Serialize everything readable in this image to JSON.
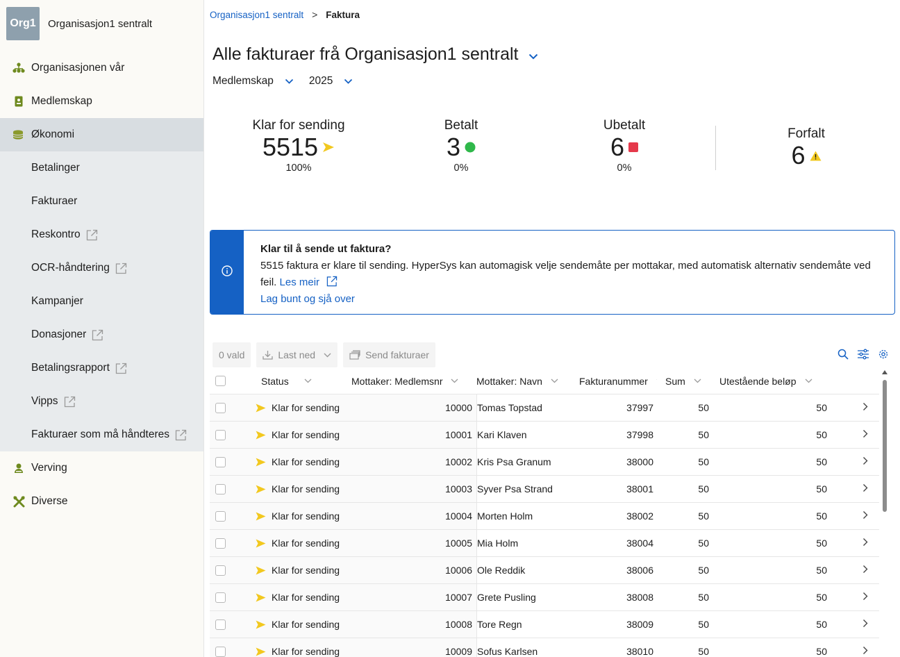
{
  "sidebar": {
    "org_logo": "Org1",
    "org_name": "Organisasjon1 sentralt",
    "items": [
      {
        "label": "Organisasjonen vår",
        "icon": "org-tree-icon"
      },
      {
        "label": "Medlemskap",
        "icon": "member-card-icon"
      },
      {
        "label": "Økonomi",
        "icon": "coins-icon",
        "active": true
      },
      {
        "label": "Verving",
        "icon": "recruit-icon"
      },
      {
        "label": "Diverse",
        "icon": "tools-icon"
      }
    ],
    "sub_items": [
      {
        "label": "Betalinger",
        "external": false
      },
      {
        "label": "Fakturaer",
        "external": false
      },
      {
        "label": "Reskontro",
        "external": true
      },
      {
        "label": "OCR-håndtering",
        "external": true
      },
      {
        "label": "Kampanjer",
        "external": false
      },
      {
        "label": "Donasjoner",
        "external": true
      },
      {
        "label": "Betalingsrapport",
        "external": true
      },
      {
        "label": "Vipps",
        "external": true
      },
      {
        "label": "Fakturaer som må håndteres",
        "external": true
      }
    ]
  },
  "breadcrumb": {
    "parent": "Organisasjon1 sentralt",
    "separator": ">",
    "current": "Faktura"
  },
  "page": {
    "title": "Alle fakturaer frå Organisasjon1 sentralt",
    "filter_type": "Medlemskap",
    "filter_year": "2025"
  },
  "stats": {
    "ready": {
      "label": "Klar for sending",
      "value": "5515",
      "pct": "100%"
    },
    "paid": {
      "label": "Betalt",
      "value": "3",
      "pct": "0%"
    },
    "unpaid": {
      "label": "Ubetalt",
      "value": "6",
      "pct": "0%"
    },
    "overdue": {
      "label": "Forfalt",
      "value": "6"
    }
  },
  "banner": {
    "title": "Klar til å sende ut faktura?",
    "text": "5515 faktura er klare til sending. HyperSys kan automagisk velje sendemåte per mottakar, med automatisk alternativ sendemåte ved feil.",
    "read_more": "Les meir",
    "action": "Lag bunt og sjå over"
  },
  "toolbar": {
    "selected": "0 vald",
    "download": "Last ned",
    "send": "Send fakturaer"
  },
  "table": {
    "headers": {
      "status": "Status",
      "member_no": "Mottaker: Medlemsnr",
      "name": "Mottaker: Navn",
      "invoice_no": "Fakturanummer",
      "sum": "Sum",
      "outstanding": "Utestående beløp"
    },
    "rows": [
      {
        "status": "Klar for sending",
        "member_no": "10000",
        "name": "Tomas Topstad",
        "invoice_no": "37997",
        "sum": "50",
        "outstanding": "50"
      },
      {
        "status": "Klar for sending",
        "member_no": "10001",
        "name": "Kari Klaven",
        "invoice_no": "37998",
        "sum": "50",
        "outstanding": "50"
      },
      {
        "status": "Klar for sending",
        "member_no": "10002",
        "name": "Kris Psa Granum",
        "invoice_no": "38000",
        "sum": "50",
        "outstanding": "50"
      },
      {
        "status": "Klar for sending",
        "member_no": "10003",
        "name": "Syver Psa Strand",
        "invoice_no": "38001",
        "sum": "50",
        "outstanding": "50"
      },
      {
        "status": "Klar for sending",
        "member_no": "10004",
        "name": "Morten Holm",
        "invoice_no": "38002",
        "sum": "50",
        "outstanding": "50"
      },
      {
        "status": "Klar for sending",
        "member_no": "10005",
        "name": "Mia Holm",
        "invoice_no": "38004",
        "sum": "50",
        "outstanding": "50"
      },
      {
        "status": "Klar for sending",
        "member_no": "10006",
        "name": "Ole Reddik",
        "invoice_no": "38006",
        "sum": "50",
        "outstanding": "50"
      },
      {
        "status": "Klar for sending",
        "member_no": "10007",
        "name": "Grete Pusling",
        "invoice_no": "38008",
        "sum": "50",
        "outstanding": "50"
      },
      {
        "status": "Klar for sending",
        "member_no": "10008",
        "name": "Tore Regn",
        "invoice_no": "38009",
        "sum": "50",
        "outstanding": "50"
      },
      {
        "status": "Klar for sending",
        "member_no": "10009",
        "name": "Sofus Karlsen",
        "invoice_no": "38010",
        "sum": "50",
        "outstanding": "50"
      }
    ]
  },
  "colors": {
    "accent": "#1561c4",
    "ready": "#f2c81f",
    "paid": "#2fb84a",
    "unpaid": "#e5394b",
    "overdue": "#f2c81f",
    "sidebar_icon": "#6e8a1f"
  }
}
